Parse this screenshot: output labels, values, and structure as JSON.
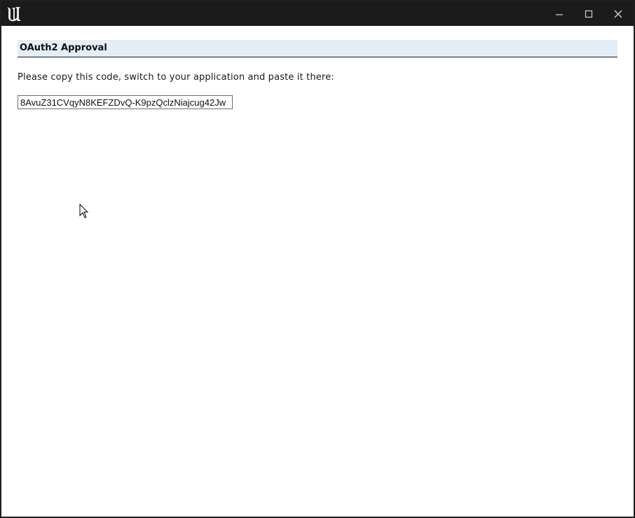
{
  "window": {
    "app_icon": "unreal-engine-logo-icon",
    "controls": [
      "minimize-icon",
      "maximize-icon",
      "close-icon"
    ]
  },
  "page": {
    "heading": "OAuth2 Approval",
    "instruction": "Please copy this code, switch to your application and paste it there:",
    "code_value": "8AvuZ31CVqyN8KEFZDvQ-K9pzQclzNiajcug42Jw"
  }
}
